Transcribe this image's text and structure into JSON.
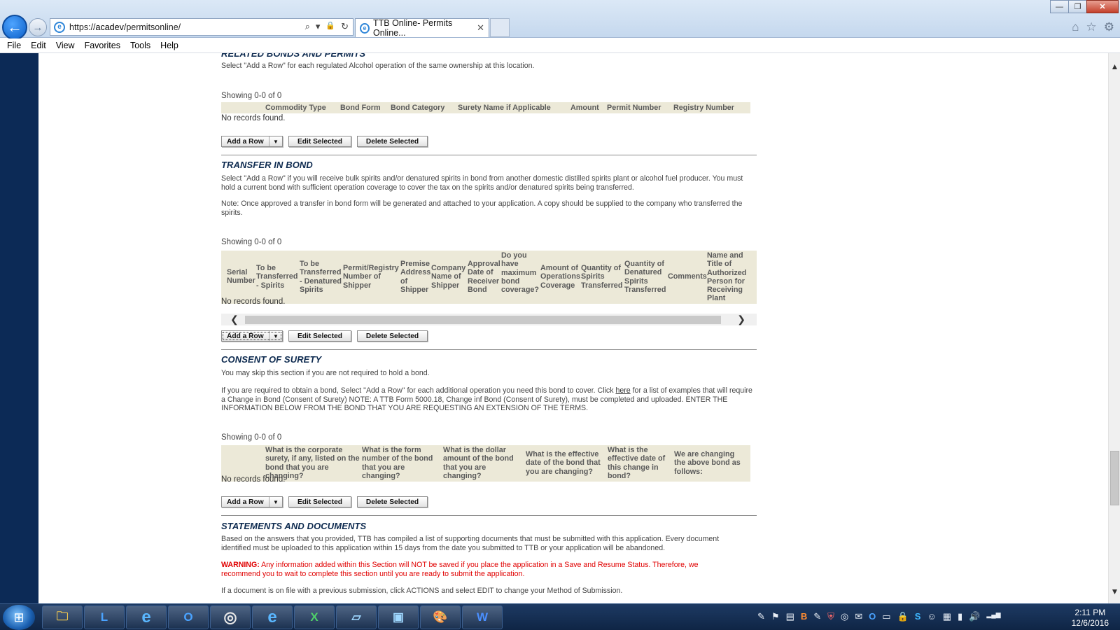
{
  "browser": {
    "url_scheme": "https://",
    "url_host": "acadev",
    "url_path": "/permitsonline/",
    "tab_title": "TTB Online- Permits Online...",
    "tab_close": "✕",
    "back_glyph": "←",
    "forward_glyph": "→",
    "win_min": "—",
    "win_max": "❐",
    "win_close": "✕",
    "address_search_icon": "⌕",
    "address_dropdown_icon": "▾",
    "address_lock_icon": "🔒",
    "address_refresh_icon": "↻",
    "home_icon": "⌂",
    "favorites_icon": "☆",
    "tools_icon": "⚙"
  },
  "menu": {
    "file": "File",
    "edit": "Edit",
    "view": "View",
    "favorites": "Favorites",
    "tools": "Tools",
    "help": "Help"
  },
  "related_bonds": {
    "title": "RELATED BONDS AND PERMITS",
    "intro": "Select \"Add a Row\" for each regulated Alcohol operation of the same ownership at this location.",
    "showing": "Showing 0-0 of 0",
    "columns": [
      "Commodity Type",
      "Bond Form",
      "Bond Category",
      "Surety Name if Applicable",
      "Amount",
      "Permit Number",
      "Registry Number"
    ],
    "no_records": "No records found."
  },
  "transfer_in_bond": {
    "title": "TRANSFER IN BOND",
    "intro": "Select \"Add a Row\" if you will receive bulk spirits and/or denatured spirits in bond from another domestic distilled spirits plant or alcohol fuel producer. You must hold a current bond with sufficient operation coverage to cover the tax on the spirits and/or denatured spirits being transferred.",
    "note": "Note: Once approved a transfer in bond form will be generated and attached to your application. A copy should be supplied to the company who transferred the spirits.",
    "showing": "Showing 0-0 of 0",
    "columns": [
      "Serial Number",
      "To be Transferred - Spirits",
      "To be Transferred - Denatured Spirits",
      "Permit/Registry Number of Shipper",
      "Premise Address of Shipper",
      "Company Name of Shipper",
      "Approval Date of Receiver Bond",
      "Do you have maximum bond coverage?",
      "Amount of Operations Coverage",
      "Quantity of Spirits Transferred",
      "Quantity of Denatured Spirits Transferred",
      "Comments",
      "Name and Title of Authorized Person for Receiving Plant"
    ],
    "no_records": "No records found.",
    "scroll_left": "❮",
    "scroll_right": "❯"
  },
  "consent_of_surety": {
    "title": "CONSENT OF SURETY",
    "skip_text": "You may skip this section if you are not required to hold a bond.",
    "instructions_before_link": "If you are required to obtain a bond, Select \"Add a Row\" for each additional operation you need this bond to cover. Click ",
    "link_text": "here",
    "instructions_after_link": " for a list of examples that will require a Change in Bond (Consent of Surety) NOTE: A TTB Form 5000.18, Change inf Bond (Consent of Surety), must be completed and uploaded. ENTER THE INFORMATION BELOW FROM THE BOND THAT YOU ARE REQUESTING AN EXTENSION OF THE TERMS.",
    "showing": "Showing 0-0 of 0",
    "columns": [
      "What is the corporate surety, if any, listed on the bond that you are changing?",
      "What is the form number of the bond that you are changing?",
      "What is the dollar amount of the bond that you are changing?",
      "What is the effective date of the bond that you are changing?",
      "What is the effective date of this change in bond?",
      "We are changing the above bond as follows:"
    ],
    "no_records": "No records found."
  },
  "statements_documents": {
    "title": "STATEMENTS AND DOCUMENTS",
    "intro": "Based on the answers that you provided, TTB has compiled a list of supporting documents that must be submitted with this application. Every document identified must be uploaded to this application within 15 days from the date you submitted to TTB or your application will be abandoned.",
    "warning_label": "WARNING:",
    "warning_text": " Any information added within this Section will NOT be saved if you place the application in a Save and Resume Status. Therefore, we recommend you to wait to complete this section until you are ready to submit the application.",
    "on_file_text": "If a document is on file with a previous submission, click ACTIONS and select EDIT to change your Method of Submission."
  },
  "buttons": {
    "add_row": "Add a Row",
    "add_row_caret": "▼",
    "edit_selected": "Edit Selected",
    "delete_selected": "Delete Selected"
  },
  "page_scrollbar": {
    "up": "▲",
    "down": "▼",
    "position": 0.83
  },
  "taskbar": {
    "start_glyph": "⊞",
    "apps": [
      {
        "name": "file-explorer",
        "glyph": "🗀"
      },
      {
        "name": "lync",
        "glyph": "L"
      },
      {
        "name": "internet-explorer",
        "glyph": "e"
      },
      {
        "name": "outlook",
        "glyph": "O"
      },
      {
        "name": "app-circle",
        "glyph": "◎"
      },
      {
        "name": "internet-explorer-2",
        "glyph": "e"
      },
      {
        "name": "excel",
        "glyph": "X"
      },
      {
        "name": "notepad",
        "glyph": "▱"
      },
      {
        "name": "photos",
        "glyph": "▣"
      },
      {
        "name": "paint",
        "glyph": "🎨"
      },
      {
        "name": "word",
        "glyph": "W"
      }
    ],
    "tray_icons": [
      "✎",
      "⚑",
      "▤",
      "B",
      "✎",
      "⛨",
      "◎",
      "✉",
      "O",
      "▭",
      "🔒",
      "S",
      "☺",
      "▦",
      "▮",
      "🔊",
      "▂▄▆"
    ],
    "time": "2:11 PM",
    "date": "12/6/2016"
  }
}
